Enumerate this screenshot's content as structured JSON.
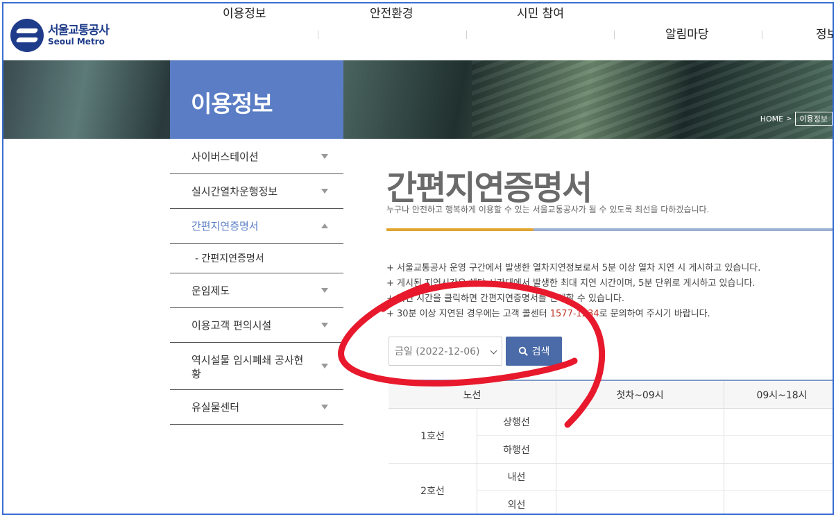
{
  "brand": {
    "name_ko": "서울교통공사",
    "name_en": "Seoul Metro",
    "color": "#1f3c8a"
  },
  "gnb": {
    "items": [
      {
        "label": "이용정보"
      },
      {
        "label": "안전환경"
      },
      {
        "label": "시민 참여"
      },
      {
        "label": "알림마당"
      },
      {
        "label": "정보"
      }
    ]
  },
  "hero": {
    "title": "이용정보",
    "breadcrumb": {
      "home": "HOME",
      "separator": ">",
      "current": "이용정보"
    }
  },
  "sidebar": {
    "items": [
      {
        "label": "사이버스테이션",
        "state": "collapsed"
      },
      {
        "label": "실시간열차운행정보",
        "state": "collapsed"
      },
      {
        "label": "간편지연증명서",
        "state": "expanded"
      },
      {
        "label": "- 간편지연증명서",
        "state": "sub"
      },
      {
        "label": "운임제도",
        "state": "collapsed"
      },
      {
        "label": "이용고객 편의시설",
        "state": "collapsed"
      },
      {
        "label": "역시설물 임시폐쇄 공사현황",
        "state": "collapsed"
      },
      {
        "label": "유실물센터",
        "state": "collapsed"
      }
    ]
  },
  "main": {
    "title": "간편지연증명서",
    "subtitle": "누구나 안전하고 행복하게 이용할 수 있는 서울교통공사가 될 수 있도록 최선을 다하겠습니다.",
    "notes": [
      "+ 서울교통공사 운영 구간에서 발생한 열차지연정보로서 5분 이상 열차 지연 시 게시하고 있습니다.",
      "+ 게시된 지연시간은 해당 시간대에서 발생한 최대 지연 시간이며, 5분 단위로 게시하고 있습니다.",
      "+ 지연 시간을 클릭하면 간편지연증명서를 인쇄할 수 있습니다."
    ],
    "note4": {
      "before": "+ 30분 이상 지연된 경우에는 고객 콜센터 ",
      "phone": "1577-1234",
      "after": "로 문의하여 주시기 바랍니다."
    },
    "date_select": {
      "value": "금일 (2022-12-06)"
    },
    "search_button": {
      "label": "검색"
    },
    "table": {
      "headers": [
        "노선",
        "첫차~09시",
        "09시~18시"
      ],
      "rows": [
        {
          "line": "1호선",
          "directions": [
            "상행선",
            "하행선"
          ]
        },
        {
          "line": "2호선",
          "directions": [
            "내선",
            "외선"
          ]
        }
      ]
    }
  },
  "colors": {
    "accent_blue": "#5a7dc5",
    "button_blue": "#4a6aa8",
    "title_accent": "#e0a530",
    "annotation_red": "#e8192c",
    "phone_red": "#c0392b"
  }
}
